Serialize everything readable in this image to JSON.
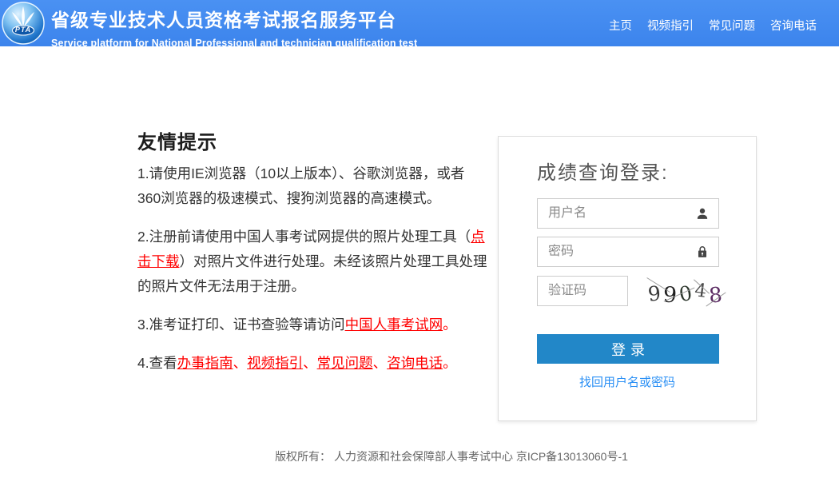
{
  "header": {
    "logo_text": "PTA",
    "title": "省级专业技术人员资格考试报名服务平台",
    "subtitle": "Service platform for National Professional and technician qualification test",
    "nav": [
      "主页",
      "视频指引",
      "常见问题",
      "咨询电话"
    ],
    "background_color": "#3c84ec"
  },
  "tips": {
    "heading": "友情提示",
    "item1": "1.请使用IE浏览器（10以上版本）、谷歌浏览器，或者360浏览器的极速模式、搜狗浏览器的高速模式。",
    "item2": {
      "pre": "2.注册前请使用中国人事考试网提供的照片处理工具（",
      "link": "点击下载",
      "post": "）对照片文件进行处理。未经该照片处理工具处理的照片文件无法用于注册。"
    },
    "item3": {
      "pre": "3.准考证打印、证书查验等请访问",
      "link": "中国人事考试网",
      "end": "。"
    },
    "item4": {
      "pre": "4.查看",
      "links": [
        "办事指南",
        "视频指引",
        "常见问题",
        "咨询电话"
      ],
      "sep": "、",
      "end": "。"
    },
    "link_color": "#ff0000"
  },
  "login": {
    "title": "成绩查询登录:",
    "username_placeholder": "用户名",
    "password_placeholder": "密码",
    "captcha_placeholder": "验证码",
    "captcha_digits": [
      "9",
      "9",
      "0",
      "4",
      "8"
    ],
    "captcha_value": "99048",
    "login_button": "登录",
    "forgot_link": "找回用户名或密码",
    "button_color": "#2287c8",
    "forgot_link_color": "#2b90f5"
  },
  "footer": {
    "text": "版权所有： 人力资源和社会保障部人事考试中心 京ICP备13013060号-1"
  }
}
